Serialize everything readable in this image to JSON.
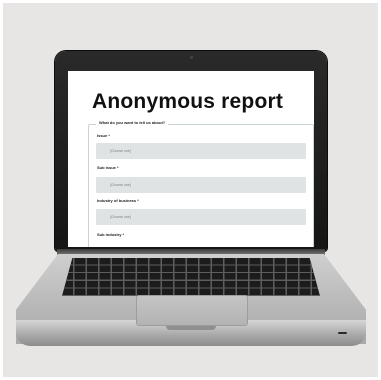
{
  "page": {
    "title": "Anonymous report",
    "legend": "What do you want to tell us about?"
  },
  "form": {
    "fields": [
      {
        "label": "Issue *",
        "placeholder": "[Choose one]"
      },
      {
        "label": "Sub issue *",
        "placeholder": "[Choose one]"
      },
      {
        "label": "Industry of business *",
        "placeholder": "[Choose one]"
      },
      {
        "label": "Sub industry *"
      }
    ]
  },
  "colors": {
    "field_background": "#dfe3e4",
    "laptop_bezel": "#151515",
    "laptop_body": "#c0c0c0"
  }
}
